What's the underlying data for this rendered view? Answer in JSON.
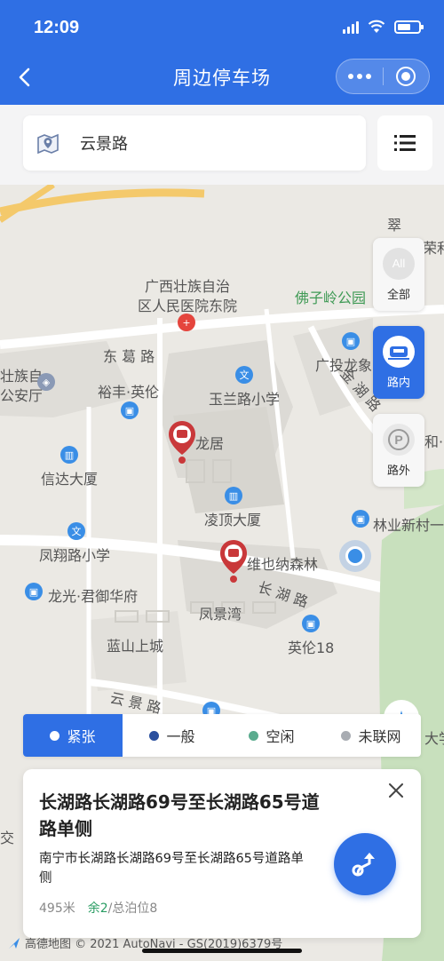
{
  "status_bar": {
    "time": "12:09"
  },
  "nav": {
    "title": "周边停车场"
  },
  "search": {
    "value": "云景路"
  },
  "map": {
    "labels": {
      "hospital": "广西壮族自治\n区人民医院东院",
      "park": "佛子岭公园",
      "donggelu": "东  葛  路",
      "yufeng": "裕丰·英伦",
      "yulan_school": "玉兰路小学",
      "guangtou": "广投龙象",
      "jinhulu": "金 湖 路",
      "xinda": "信达大厦",
      "longju": "龙居",
      "lingding": "凌顶大厦",
      "linye": "林业新村一",
      "fengxiang": "凤翔路小学",
      "weiyena": "维也纳森林",
      "longguang": "龙光·君御华府",
      "changhulu": "长 湖 路",
      "fengjingwan": "凤景湾",
      "yinglun18": "英伦18",
      "lanshan": "蓝山上城",
      "yunjinglu": "云 景 路",
      "cui": "翠",
      "rong": "荣和",
      "he": "和·公",
      "zuzi": "壮族自",
      "anting": "公安厅",
      "da": "大学",
      "jiao": "交"
    }
  },
  "filters": [
    {
      "icon_text": "All",
      "label": "全部"
    },
    {
      "icon_text": "",
      "label": "路内"
    },
    {
      "icon_text": "P",
      "label": "路外"
    }
  ],
  "legend": [
    {
      "label": "紧张",
      "color": "#ffffff"
    },
    {
      "label": "一般",
      "color": "#2a4f9e"
    },
    {
      "label": "空闲",
      "color": "#5aab8e"
    },
    {
      "label": "未联网",
      "color": "#a8acb2"
    }
  ],
  "card": {
    "name": "长湖路长湖路69号至长湖路65号道路单侧",
    "address": "南宁市长湖路长湖路69号至长湖路65号道路单侧",
    "distance": "495米",
    "remaining": "余2",
    "total": "/总泊位8"
  },
  "copyright": "高德地图 © 2021 AutoNavi - GS(2019)6379号"
}
